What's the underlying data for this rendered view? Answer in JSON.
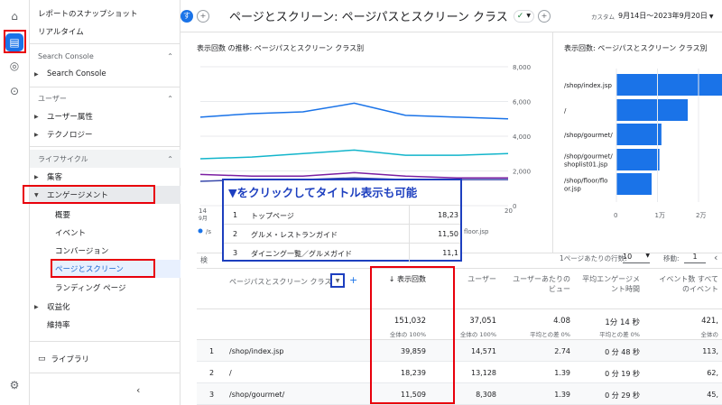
{
  "sidebar": {
    "items": [
      {
        "label": "レポートのスナップショット"
      },
      {
        "label": "リアルタイム"
      },
      {
        "label": "Search Console"
      },
      {
        "label": "Search Console"
      },
      {
        "label": "ユーザー"
      },
      {
        "label": "ユーザー属性"
      },
      {
        "label": "テクノロジー"
      },
      {
        "label": "ライフサイクル"
      },
      {
        "label": "集客"
      },
      {
        "label": "エンゲージメント"
      },
      {
        "label": "概要"
      },
      {
        "label": "イベント"
      },
      {
        "label": "コンバージョン"
      },
      {
        "label": "ページとスクリーン"
      },
      {
        "label": "ランディング ページ"
      },
      {
        "label": "収益化"
      },
      {
        "label": "維持率"
      }
    ],
    "library": "ライブラリ"
  },
  "header": {
    "avatar": "す",
    "title": "ページとスクリーン: ページパスとスクリーン クラス",
    "custom": "カスタム",
    "date": "9月14日～2023年9月20日"
  },
  "line_chart": {
    "title": "表示回数 の推移: ページパスとスクリーン クラス別",
    "yticks": [
      "8,000",
      "6,000",
      "4,000",
      "2,000",
      "0"
    ],
    "xticks": [
      "14\n9月",
      "15",
      "16",
      "17",
      "18",
      "19",
      "20"
    ],
    "legend_tail": "floor.jsp"
  },
  "chart_data": [
    {
      "type": "line",
      "xlabel": "",
      "ylabel": "",
      "ylim": [
        0,
        8000
      ],
      "x": [
        "14",
        "15",
        "16",
        "17",
        "18",
        "19",
        "20"
      ],
      "series": [
        {
          "values": [
            5100,
            5300,
            5400,
            5900,
            5200,
            5100,
            5000
          ],
          "color": "#1a73e8"
        },
        {
          "values": [
            2700,
            2800,
            3000,
            3200,
            2900,
            2900,
            3000
          ],
          "color": "#12b5cb"
        },
        {
          "values": [
            1800,
            1700,
            1700,
            1900,
            1700,
            1600,
            1600
          ],
          "color": "#7b1fa2"
        },
        {
          "values": [
            1400,
            1500,
            1500,
            1600,
            1500,
            1500,
            1500
          ],
          "color": "#3949ab"
        }
      ]
    },
    {
      "type": "bar",
      "title": "表示回数: ページパスとスクリーン クラス別",
      "categories": [
        "/shop/index.jsp",
        "/",
        "/shop/gourmet/",
        "/shop/gourmet/\nshoplist01.jsp",
        "/shop/floor/flo\nor.jsp"
      ],
      "values": [
        39859,
        18239,
        11509,
        11000,
        9000
      ],
      "xticks": [
        "0",
        "1万",
        "2万"
      ]
    }
  ],
  "callout": {
    "title": "▼をクリックしてタイトル表示も可能",
    "rows": [
      {
        "n": "1",
        "label": "トップページ",
        "val": "18,23"
      },
      {
        "n": "2",
        "label": "グルメ・レストランガイド",
        "val": "11,50"
      },
      {
        "n": "3",
        "label": "ダイニング一覧／グルメガイド",
        "val": "11,1"
      }
    ]
  },
  "table": {
    "search_hint": "検",
    "rows_label": "1ページあたりの行数:",
    "rows_value": "10",
    "goto_label": "移動:",
    "goto_value": "1",
    "dimension_header": "ページパスとスクリーン クラス",
    "columns": [
      {
        "label": "↓ 表示回数"
      },
      {
        "label": "ユーザー"
      },
      {
        "label": "ユーザーあたりのビュー"
      },
      {
        "label": "平均エンゲージメント時間"
      },
      {
        "label": "イベント数 すべてのイベント"
      }
    ],
    "totals": [
      "151,032",
      "37,051",
      "4.08",
      "1分 14 秒",
      "421,"
    ],
    "totals_sub": [
      "全体の 100%",
      "全体の 100%",
      "平均との差 0%",
      "平均との差 0%",
      "全体の"
    ],
    "rows": [
      {
        "n": "1",
        "path": "/shop/index.jsp",
        "v": [
          "39,859",
          "14,571",
          "2.74",
          "0 分 48 秒",
          "113,"
        ]
      },
      {
        "n": "2",
        "path": "/",
        "v": [
          "18,239",
          "13,128",
          "1.39",
          "0 分 19 秒",
          "62,"
        ]
      },
      {
        "n": "3",
        "path": "/shop/gourmet/",
        "v": [
          "11,509",
          "8,308",
          "1.39",
          "0 分 29 秒",
          "45,"
        ]
      }
    ]
  }
}
